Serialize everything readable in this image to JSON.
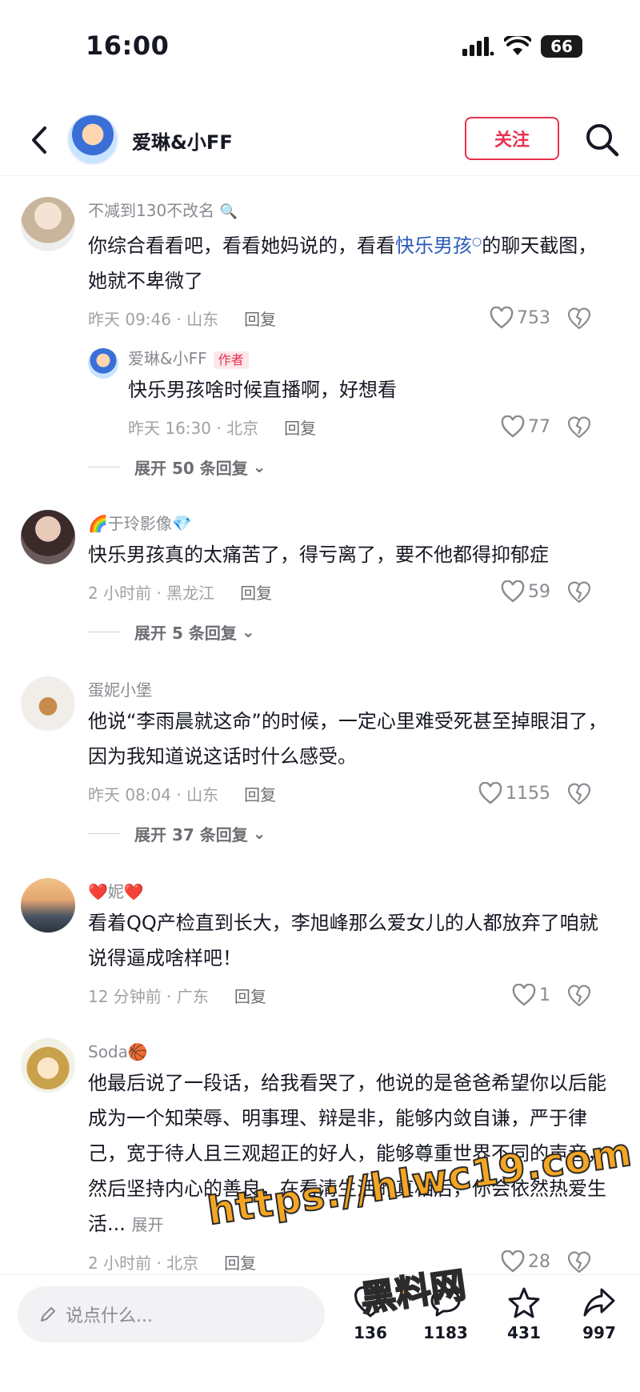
{
  "status": {
    "time": "16:00",
    "battery": "66"
  },
  "header": {
    "name": "爱琳&小FF",
    "follow": "关注"
  },
  "comments": [
    {
      "nick": "不减到130不改名",
      "text_before": "你综合看看吧，看看她妈说的，看看",
      "link": "快乐男孩",
      "text_after": "的聊天截图，她就不卑微了",
      "time": "昨天 09:46 · 山东",
      "reply": "回复",
      "likes": "753",
      "author_reply": {
        "nick": "爱琳&小FF",
        "tag": "作者",
        "text": "快乐男孩啥时候直播啊，好想看",
        "time": "昨天 16:30 · 北京",
        "reply": "回复",
        "likes": "77"
      },
      "expand": "展开 50 条回复"
    },
    {
      "nick": "🌈于玲影像💎",
      "text": "快乐男孩真的太痛苦了，得亏离了，要不他都得抑郁症",
      "time": "2 小时前 · 黑龙江",
      "reply": "回复",
      "likes": "59",
      "expand": "展开 5 条回复"
    },
    {
      "nick": "蛋妮小堡",
      "text": "他说“李雨晨就这命”的时候，一定心里难受死甚至掉眼泪了， 因为我知道说这话时什么感受。",
      "time": "昨天 08:04 · 山东",
      "reply": "回复",
      "likes": "1155",
      "expand": "展开 37 条回复"
    },
    {
      "nick": "❤️妮❤️",
      "text": "看着QQ产检直到长大，李旭峰那么爱女儿的人都放弃了咱就说得逼成啥样吧！",
      "time": "12 分钟前 · 广东",
      "reply": "回复",
      "likes": "1"
    },
    {
      "nick": "Soda🏀",
      "text": "他最后说了一段话，给我看哭了，他说的是爸爸希望你以后能成为一个知荣辱、明事理、辩是非，能够内敛自谦，严于律己，宽于待人且三观超正的好人，能够尊重世界不同的声音，然后坚持内心的善良，在看清生活的真相后，你会依然热爱生活...",
      "more": "展开",
      "time": "2 小时前 · 北京",
      "reply": "回复",
      "likes": "28"
    }
  ],
  "bottom": {
    "placeholder": "说点什么...",
    "likes": "136",
    "comments": "1183",
    "favorites": "431",
    "shares": "997"
  },
  "watermark": {
    "url": "https://hlwc19.com",
    "label": "黑料网"
  }
}
